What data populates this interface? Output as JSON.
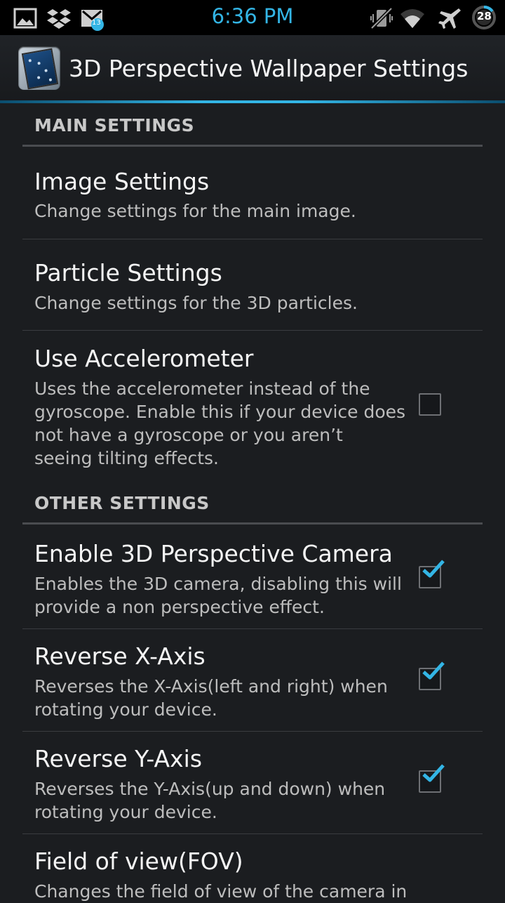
{
  "status_bar": {
    "time": "6:36 PM",
    "notification_count": "13",
    "battery_level": "28",
    "icons": [
      "image-icon",
      "dropbox-icon",
      "gmail-icon",
      "vibrate-icon",
      "wifi-icon",
      "airplane-icon",
      "battery-icon"
    ]
  },
  "action_bar": {
    "title": "3D Perspective Wallpaper Settings",
    "accent_color": "#33b5e5"
  },
  "sections": [
    {
      "header": "MAIN SETTINGS",
      "items": [
        {
          "title": "Image Settings",
          "summary": "Change settings for the main image."
        },
        {
          "title": "Particle Settings",
          "summary": "Change settings for the 3D particles."
        },
        {
          "title": "Use Accelerometer",
          "summary": "Uses the accelerometer instead of the gyroscope. Enable this if your device does not have a gyroscope or you aren’t seeing tilting effects.",
          "checked": false
        }
      ]
    },
    {
      "header": "OTHER SETTINGS",
      "items": [
        {
          "title": "Enable 3D Perspective Camera",
          "summary": "Enables the 3D camera, disabling this will provide a non perspective effect.",
          "checked": true
        },
        {
          "title": "Reverse X-Axis",
          "summary": "Reverses the X-Axis(left and right) when rotating your device.",
          "checked": true
        },
        {
          "title": "Reverse Y-Axis",
          "summary": "Reverses the Y-Axis(up and down) when rotating your device.",
          "checked": true
        },
        {
          "title": "Field of view(FOV)",
          "summary": "Changes the field of view of the camera in"
        }
      ]
    }
  ]
}
